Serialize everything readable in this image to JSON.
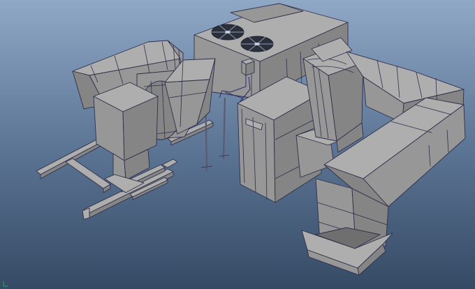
{
  "viewport": {
    "background_top": "#8fa8c6",
    "background_bottom": "#354a64",
    "mesh_fill": "#aeaeae",
    "wireframe_color": "#2e2e4a"
  },
  "scene": {
    "objects": [
      "condenser-unit",
      "condenser-fan-1",
      "condenser-fan-2",
      "electrical-box",
      "air-handler",
      "blower-housing",
      "transition-duct",
      "left-curved-duct",
      "right-curved-duct",
      "long-straight-duct",
      "vertical-drop-duct",
      "support-frame"
    ],
    "fans": [
      {
        "name": "condenser-fan-1",
        "blades": 6
      },
      {
        "name": "condenser-fan-2",
        "blades": 6
      }
    ]
  },
  "gizmo": {
    "axis_color": "#2f8f5a"
  }
}
